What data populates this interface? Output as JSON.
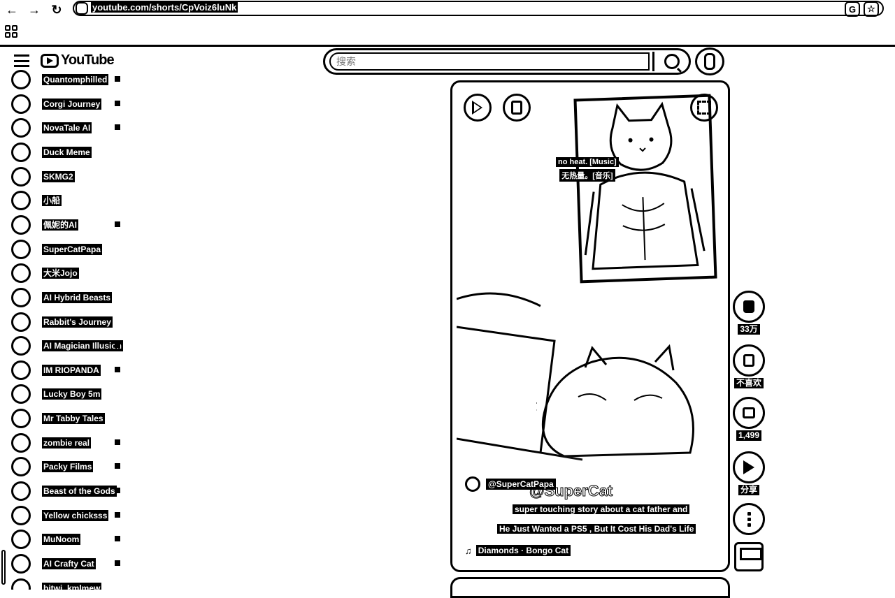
{
  "browser": {
    "url": "youtube.com/shorts/CpVoiz6luNk",
    "back_icon": "arrow-left-icon",
    "forward_icon": "arrow-right-icon",
    "reload_icon": "reload-icon"
  },
  "header": {
    "logo_text": "YouTube",
    "search_placeholder": "搜索"
  },
  "sidebar": {
    "subscriptions": [
      {
        "name": "Quantomphilled",
        "dot": "filled"
      },
      {
        "name": "Corgi Journey",
        "dot": "filled"
      },
      {
        "name": "NovaTale AI",
        "dot": "filled"
      },
      {
        "name": "Duck Meme",
        "dot": "none"
      },
      {
        "name": "SKMG2",
        "dot": "none"
      },
      {
        "name": "小船",
        "dot": "none"
      },
      {
        "name": "佩妮的AI",
        "dot": "filled"
      },
      {
        "name": "SuperCatPapa",
        "dot": "none"
      },
      {
        "name": "大米Jojo",
        "dot": "none"
      },
      {
        "name": "AI Hybrid Beasts",
        "dot": "none"
      },
      {
        "name": "Rabbit's Journey",
        "dot": "none"
      },
      {
        "name": "AI Magician Illusion",
        "dot": "filled"
      },
      {
        "name": "IM RIOPANDA",
        "dot": "filled"
      },
      {
        "name": "Lucky Boy 5m",
        "dot": "none"
      },
      {
        "name": "Mr Tabby Tales",
        "dot": "none"
      },
      {
        "name": "zombie real",
        "dot": "filled"
      },
      {
        "name": "Packy Films",
        "dot": "filled"
      },
      {
        "name": "Beast of the Gods",
        "dot": "filled"
      },
      {
        "name": "Yellow chicksss",
        "dot": "filled"
      },
      {
        "name": "MuNoom",
        "dot": "filled"
      },
      {
        "name": "AI Crafty Cat",
        "dot": "filled"
      },
      {
        "name": "bitwi_kmlmew",
        "dot": "none"
      }
    ]
  },
  "player": {
    "caption_line1": "no heat. [Music]",
    "caption_line2": "无热量。[音乐]",
    "watermark": "@SuperCat",
    "channel": "@SuperCatPapa",
    "description_line1": "super touching story about a cat father and",
    "description_line2": "He Just Wanted a PS5 , But It Cost His Dad's Life",
    "music": "Diamonds · Bongo Cat"
  },
  "actions": {
    "like_count": "33万",
    "dislike_label": "不喜欢",
    "comment_count": "1,499",
    "share_label": "分享"
  }
}
